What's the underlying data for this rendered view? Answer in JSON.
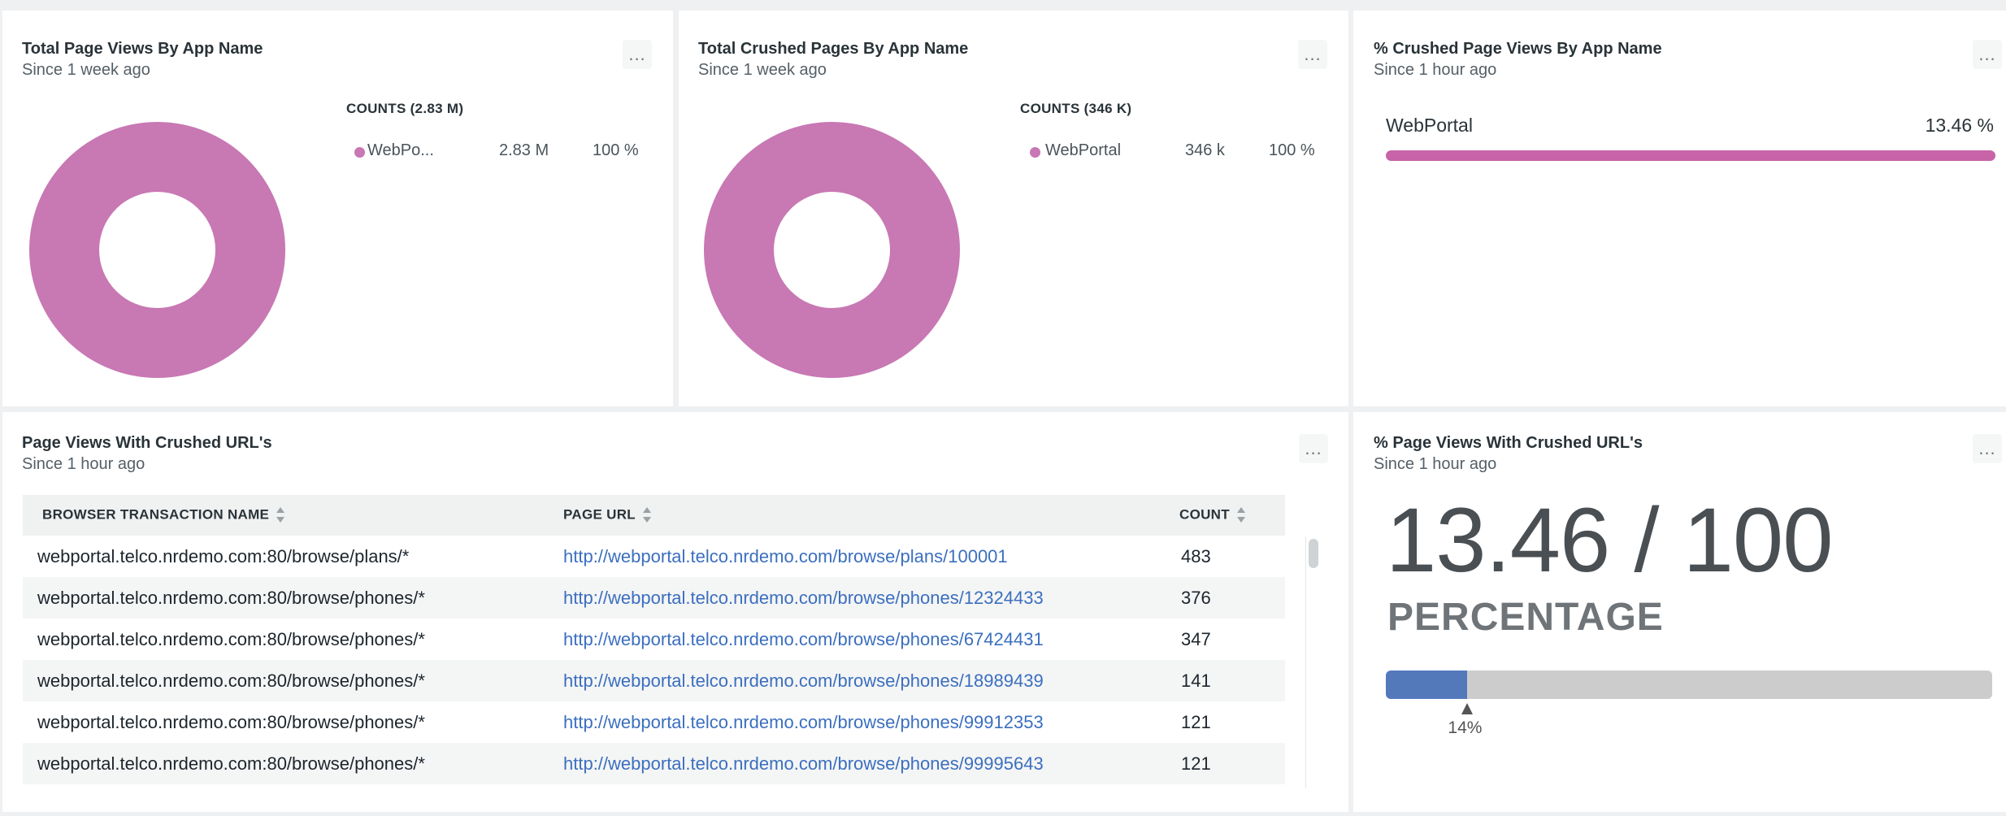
{
  "panels": {
    "page_views": {
      "title": "Total Page Views By App Name",
      "subtitle": "Since 1 week ago",
      "legend_header": "COUNTS (2.83 M)",
      "legend_item": {
        "name": "WebPo...",
        "value": "2.83 M",
        "percent": "100 %"
      },
      "color": "#c878b3"
    },
    "crushed_pages": {
      "title": "Total Crushed Pages By App Name",
      "subtitle": "Since 1 week ago",
      "legend_header": "COUNTS (346 K)",
      "legend_item": {
        "name": "WebPortal",
        "value": "346 k",
        "percent": "100 %"
      },
      "color": "#c878b3"
    },
    "pct_crushed": {
      "title": "% Crushed Page Views By App Name",
      "subtitle": "Since 1 hour ago",
      "bar_label": "WebPortal",
      "bar_value": "13.46 %",
      "bar_fill_fraction": 1.0,
      "color": "#c863a8"
    },
    "table": {
      "title": "Page Views With Crushed URL's",
      "subtitle": "Since 1 hour ago",
      "columns": [
        "BROWSER TRANSACTION NAME",
        "PAGE URL",
        "COUNT"
      ],
      "rows": [
        [
          "webportal.telco.nrdemo.com:80/browse/plans/*",
          "http://webportal.telco.nrdemo.com/browse/plans/100001",
          "483"
        ],
        [
          "webportal.telco.nrdemo.com:80/browse/phones/*",
          "http://webportal.telco.nrdemo.com/browse/phones/12324433",
          "376"
        ],
        [
          "webportal.telco.nrdemo.com:80/browse/phones/*",
          "http://webportal.telco.nrdemo.com/browse/phones/67424431",
          "347"
        ],
        [
          "webportal.telco.nrdemo.com:80/browse/phones/*",
          "http://webportal.telco.nrdemo.com/browse/phones/18989439",
          "141"
        ],
        [
          "webportal.telco.nrdemo.com:80/browse/phones/*",
          "http://webportal.telco.nrdemo.com/browse/phones/99912353",
          "121"
        ],
        [
          "webportal.telco.nrdemo.com:80/browse/phones/*",
          "http://webportal.telco.nrdemo.com/browse/phones/99995643",
          "121"
        ]
      ]
    },
    "billboard": {
      "title": "% Page Views With Crushed URL's",
      "subtitle": "Since 1 hour ago",
      "value": "13.46 / 100",
      "unit": "PERCENTAGE",
      "gauge_fraction": 0.1346,
      "gauge_label": "14%",
      "gauge_color": "#5479bb"
    }
  },
  "menu_label": "..."
}
